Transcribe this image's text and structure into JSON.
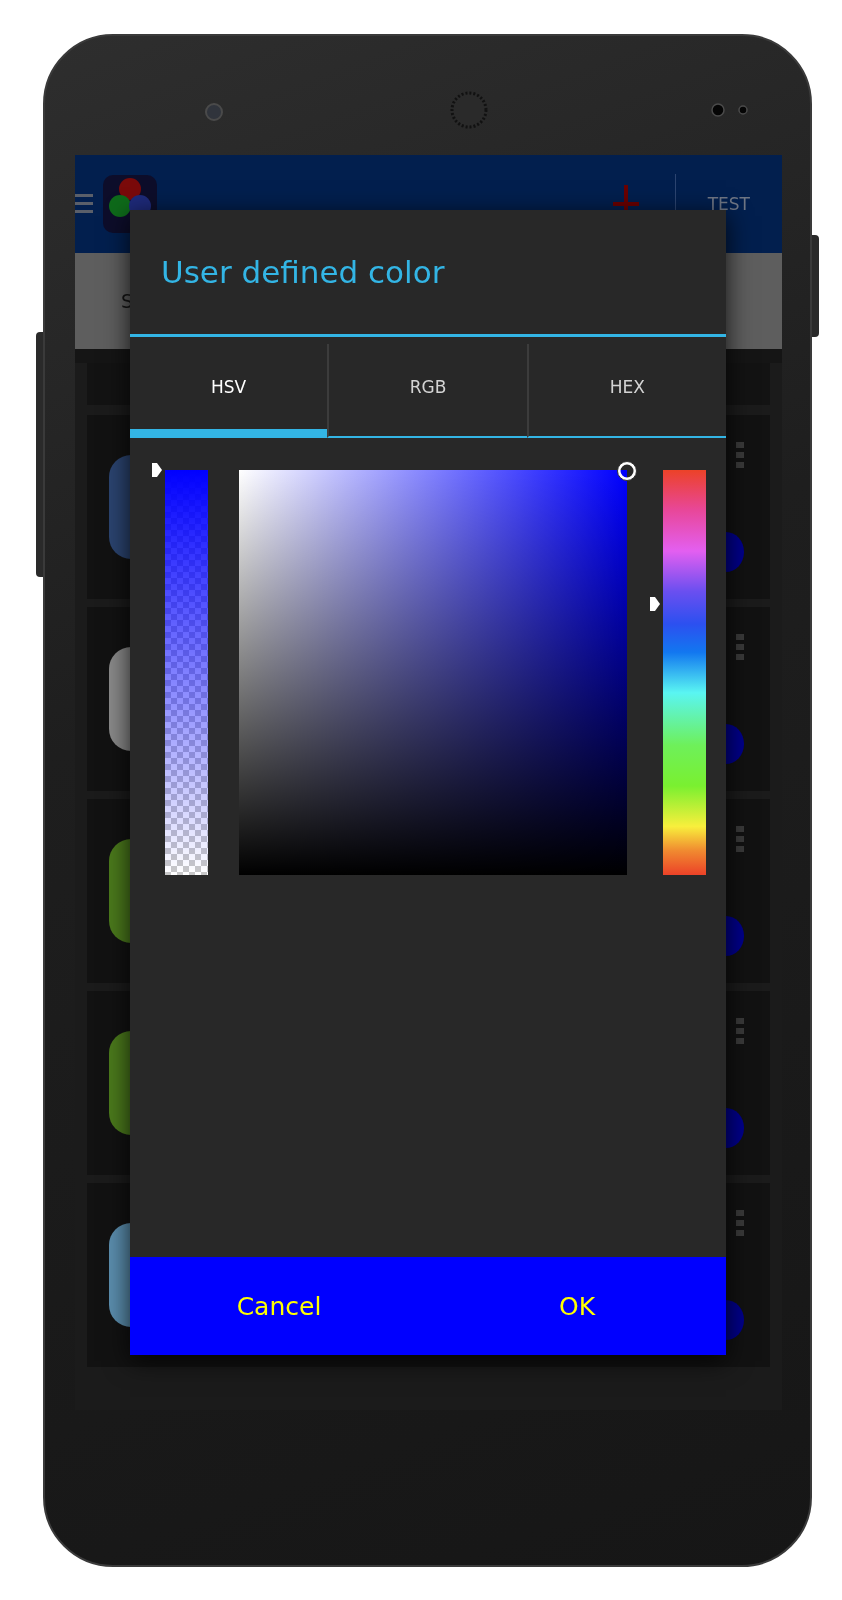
{
  "app_bar": {
    "action": "TEST"
  },
  "tab_strip": {
    "label": "S"
  },
  "list_rows": [
    {
      "color": "#2b4470"
    },
    {
      "color": "#8a8a8a"
    },
    {
      "color": "#4b7a1c"
    },
    {
      "color": "#4b7a1c"
    },
    {
      "color": "#5b8eae"
    }
  ],
  "dialog": {
    "title": "User defined color",
    "tabs": [
      {
        "label": "HSV",
        "selected": true
      },
      {
        "label": "RGB",
        "selected": false
      },
      {
        "label": "HEX",
        "selected": false
      }
    ],
    "alpha_slider": {
      "level": 1
    },
    "hue_slider": {
      "level": 0.67
    },
    "buttons": [
      {
        "label": "Cancel"
      },
      {
        "label": "OK"
      }
    ]
  }
}
